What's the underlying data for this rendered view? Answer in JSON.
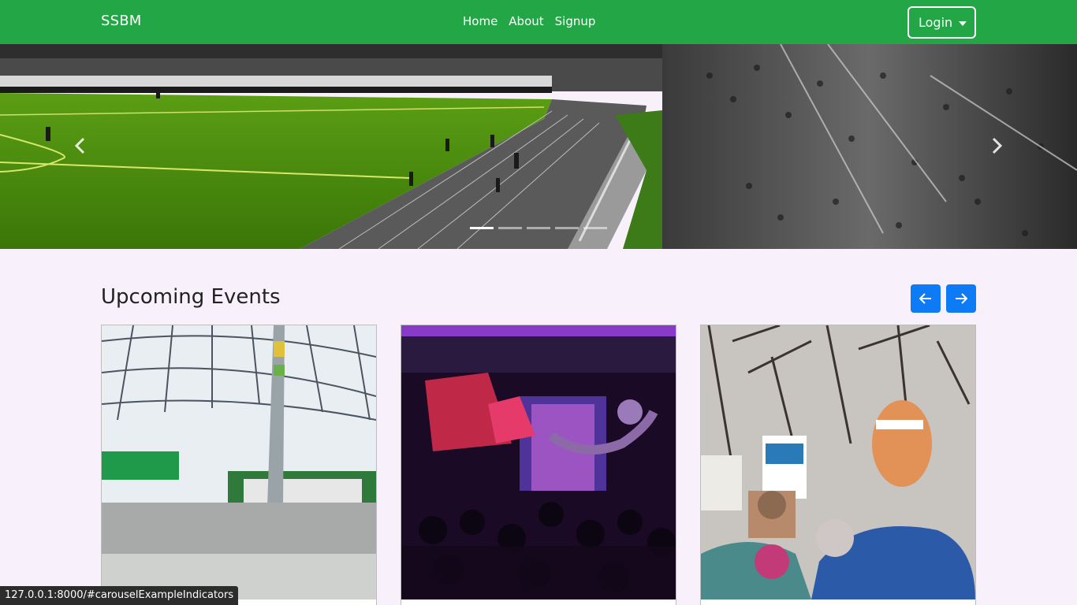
{
  "navbar": {
    "brand": "SSBM",
    "links": [
      {
        "label": "Home"
      },
      {
        "label": "About"
      },
      {
        "label": "Signup"
      }
    ],
    "login_label": "Login"
  },
  "carousel": {
    "slide_count": 5,
    "active_index": 0
  },
  "events": {
    "title": "Upcoming Events"
  },
  "status_bar": {
    "url": "127.0.0.1:8000/#carouselExampleIndicators"
  },
  "colors": {
    "navbar": "#23a645",
    "page_background": "#f8f1fb",
    "arrow_button": "#0d7bf6"
  }
}
